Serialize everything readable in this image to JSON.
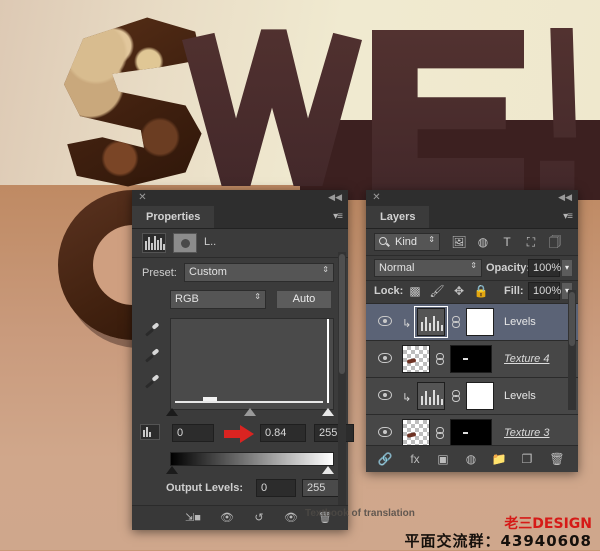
{
  "artwork": {
    "headline": "SWE!",
    "description": "chocolate-lettering-composition"
  },
  "properties_panel": {
    "title": "Properties",
    "close_icon": "✕",
    "collapse_icon": "◀◀",
    "menu_icon": "▾≡",
    "adjustment_label": "L..",
    "histogram_icon": "histogram-icon",
    "circle_icon": "circle-icon",
    "preset": {
      "label": "Preset:",
      "value": "Custom"
    },
    "channel": {
      "value": "RGB"
    },
    "auto_button": "Auto",
    "input_levels": {
      "black": "0",
      "gamma": "0.84",
      "white": "255"
    },
    "output_levels": {
      "label": "Output Levels:",
      "black": "0",
      "white": "255"
    },
    "footer_icons": [
      "clip-to-layer-icon",
      "view-previous-state-icon",
      "reset-icon",
      "visibility-icon",
      "delete-icon"
    ]
  },
  "layers_panel": {
    "title": "Layers",
    "close_icon": "✕",
    "collapse_icon": "◀◀",
    "menu_icon": "▾≡",
    "filter": {
      "kind": "Kind",
      "icons": [
        "pixel-layer-filter-icon",
        "adjustment-layer-filter-icon",
        "type-layer-filter-icon",
        "shape-layer-filter-icon",
        "smart-object-filter-icon"
      ]
    },
    "blend_mode": "Normal",
    "opacity": {
      "label": "Opacity:",
      "value": "100%"
    },
    "lock": {
      "label": "Lock:",
      "icons": [
        "lock-transparency-icon",
        "lock-image-icon",
        "lock-position-icon",
        "lock-all-icon"
      ]
    },
    "fill": {
      "label": "Fill:",
      "value": "100%"
    },
    "rows": [
      {
        "name": "Levels",
        "selected": true,
        "type": "adjustment",
        "clipped": true,
        "mask": "white"
      },
      {
        "name": "Texture 4",
        "selected": false,
        "type": "pixel",
        "clipped": false,
        "mask": "black"
      },
      {
        "name": "Levels",
        "selected": false,
        "type": "adjustment",
        "clipped": true,
        "mask": "white"
      },
      {
        "name": "Texture 3",
        "selected": false,
        "type": "pixel",
        "clipped": false,
        "mask": "black"
      }
    ],
    "footer_icons": [
      "link-layers-icon",
      "layer-style-fx-icon",
      "add-mask-icon",
      "new-adjustment-icon",
      "new-group-icon",
      "new-layer-icon",
      "delete-layer-icon"
    ]
  },
  "watermark": {
    "tooltip": "Textbook of translation",
    "brand": "老三DESIGN",
    "group": "平面交流群：43940608"
  },
  "colors": {
    "panel_bg": "#3b3b3b",
    "panel_header": "#2e2e2e",
    "selected_row": "#5b6376",
    "accent_red": "#d61a17",
    "arrow_red": "#d92421"
  }
}
